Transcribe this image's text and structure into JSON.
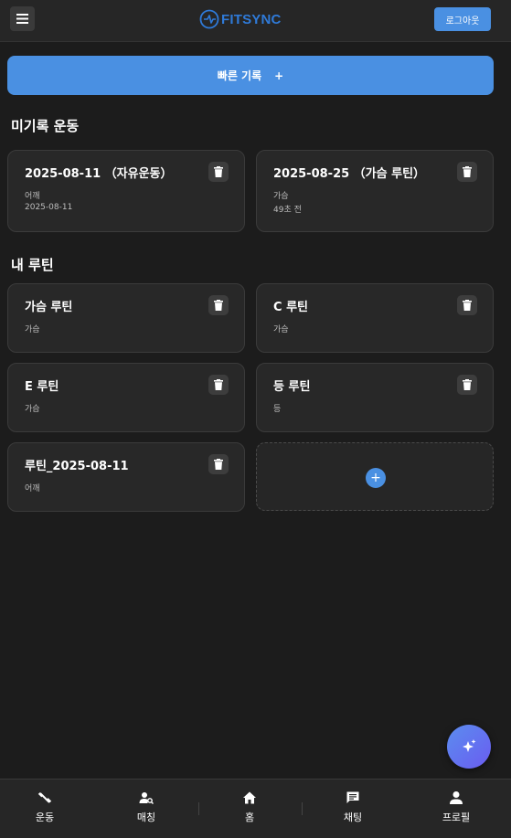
{
  "header": {
    "logo_text": "FITSYNC",
    "logout_label": "로그아웃",
    "brand_color": "#2f7ad8"
  },
  "quick_record": {
    "label": "빠른 기록",
    "plus": "+"
  },
  "unrecorded": {
    "title": "미기록 운동",
    "items": [
      {
        "title": "2025-08-11 （자유운동）",
        "line1": "어깨",
        "line2": "2025-08-11"
      },
      {
        "title": "2025-08-25 （가슴 루틴）",
        "line1": "가슴",
        "line2": "49초 전"
      }
    ]
  },
  "routines": {
    "title": "내 루틴",
    "items": [
      {
        "title": "가슴 루틴",
        "sub": "가슴"
      },
      {
        "title": "C 루틴",
        "sub": "가슴"
      },
      {
        "title": "E 루틴",
        "sub": "가슴"
      },
      {
        "title": "등 루틴",
        "sub": "등"
      },
      {
        "title": "루틴_2025-08-11",
        "sub": "어깨"
      }
    ],
    "add_plus": "+"
  },
  "bottom_nav": [
    {
      "label": "운동",
      "icon": "workout-icon"
    },
    {
      "label": "매칭",
      "icon": "matching-icon"
    },
    {
      "label": "홈",
      "icon": "home-icon"
    },
    {
      "label": "채팅",
      "icon": "chat-icon"
    },
    {
      "label": "프로필",
      "icon": "profile-icon"
    }
  ],
  "colors": {
    "accent": "#4a90e2",
    "background": "#1c1c1c",
    "card": "#282828"
  }
}
